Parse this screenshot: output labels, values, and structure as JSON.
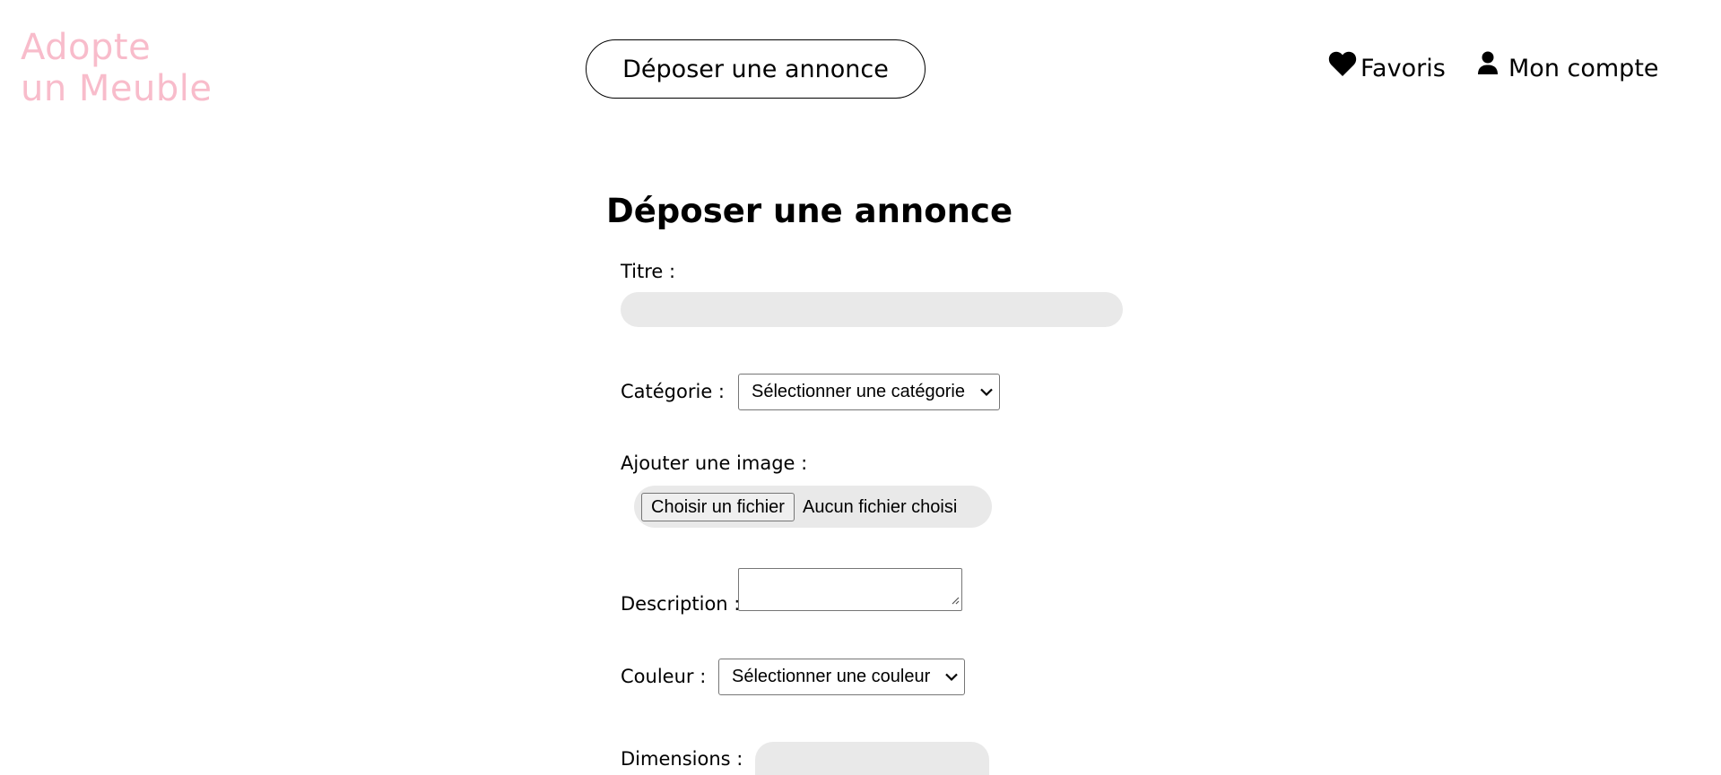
{
  "header": {
    "logo_line1": "Adopte",
    "logo_line2": "un Meuble",
    "deposit_button": "Déposer une annonce",
    "favorites_label": "Favoris",
    "account_label": "Mon compte"
  },
  "form": {
    "title": "Déposer une annonce",
    "titre_label": "Titre :",
    "titre_value": "",
    "categorie_label": "Catégorie :",
    "categorie_selected": "Sélectionner une catégorie",
    "image_label": "Ajouter une image :",
    "file_button": "Choisir un fichier",
    "file_status": "Aucun fichier choisi",
    "description_label": "Description :",
    "description_value": "",
    "couleur_label": "Couleur :",
    "couleur_selected": "Sélectionner une couleur",
    "dimensions_label": "Dimensions :",
    "dimensions_value": ""
  },
  "colors": {
    "logo": "#f8bccb",
    "input_bg": "#e9e9e9"
  },
  "icons": {
    "favorites": "heart-icon",
    "account": "user-icon",
    "select_arrow": "chevron-down-icon",
    "resize": "resize-grip-icon"
  }
}
